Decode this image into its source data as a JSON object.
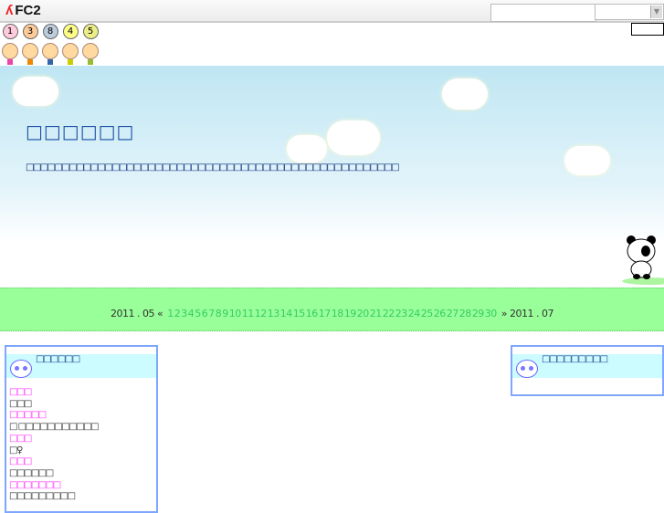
{
  "fc2bar": {
    "logo": "FC2"
  },
  "rank_numbers": [
    "1",
    "3",
    "8",
    "4",
    "5"
  ],
  "header": {
    "title": "□□□□□□",
    "description": "□□□□□□□□□□□□□□□□□□□□□□□□□□□□□□□□□□□□□□□□□□□□□□□□□□□□"
  },
  "calendar": {
    "prev": "2011 . 05 «",
    "next": "» 2011 . 07",
    "days": [
      "1",
      "2",
      "3",
      "4",
      "5",
      "6",
      "7",
      "8",
      "9",
      "10",
      "11",
      "12",
      "13",
      "14",
      "15",
      "16",
      "17",
      "18",
      "19",
      "20",
      "21",
      "22",
      "23",
      "24",
      "25",
      "26",
      "27",
      "28",
      "29",
      "30"
    ]
  },
  "left_box": {
    "title": "□□□□□□",
    "items": [
      {
        "text": "□□□",
        "style": "m"
      },
      {
        "text": "□□□",
        "style": "n"
      },
      {
        "text": "□□□□□",
        "style": "m"
      },
      {
        "text": "□ □□□□□□□□□□□",
        "style": "n"
      },
      {
        "text": "□□□",
        "style": "m"
      },
      {
        "text": "□♀",
        "style": "n"
      },
      {
        "text": "□□□",
        "style": "m"
      },
      {
        "text": "□□□□□□",
        "style": "n"
      },
      {
        "text": "□□□□□□□",
        "style": "m"
      },
      {
        "text": "□□□□□□□□□",
        "style": "n"
      }
    ]
  },
  "right_box": {
    "title": "□□□□□□□□□"
  },
  "colors": {
    "calendar_bg": "#99ff99",
    "link": "#33cc66",
    "box_border": "#7fa7ff",
    "accent_magenta": "#ff33ff"
  }
}
